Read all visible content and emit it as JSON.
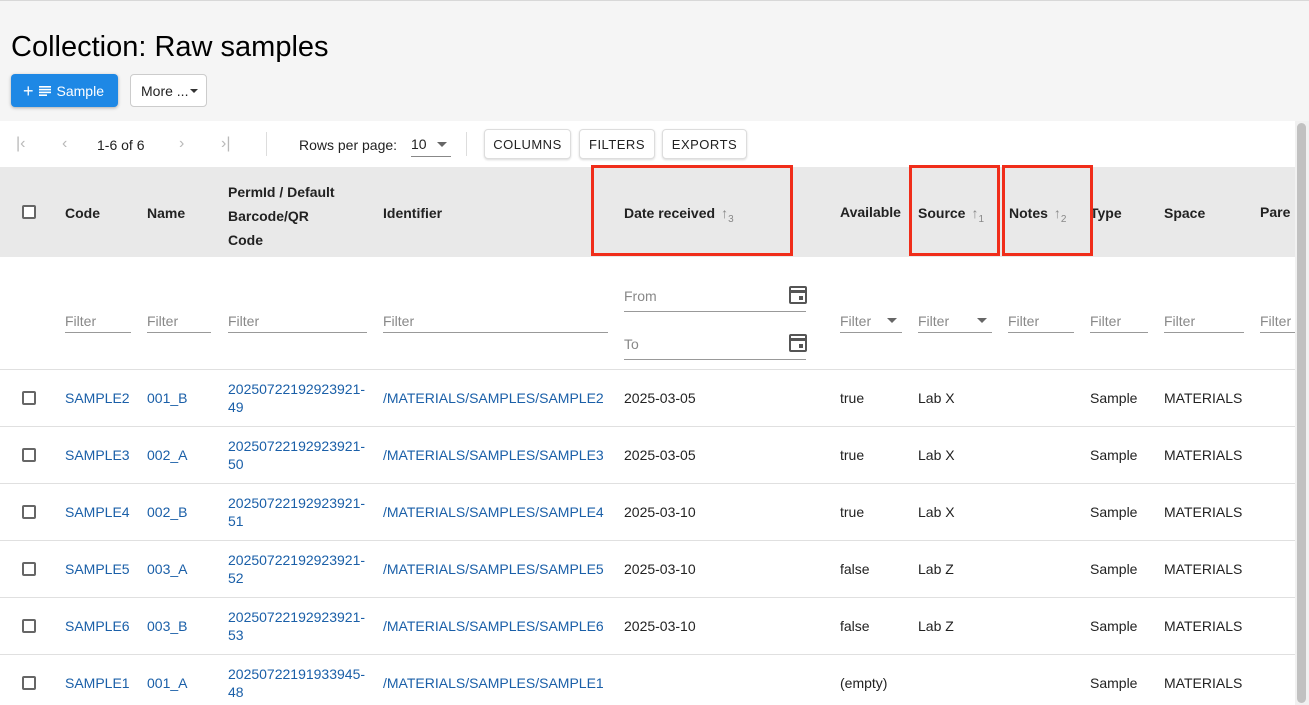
{
  "page": {
    "title": "Collection: Raw samples"
  },
  "actions": {
    "add_label": "Sample",
    "more_label": "More ..."
  },
  "toolbar": {
    "range": "1-6 of 6",
    "rows_per_page_label": "Rows per page:",
    "rows_per_page_value": "10",
    "columns_label": "COLUMNS",
    "filters_label": "FILTERS",
    "exports_label": "EXPORTS"
  },
  "columns": {
    "code": "Code",
    "name": "Name",
    "permid_line1": "PermId / Default",
    "permid_line2": "Barcode/QR",
    "permid_line3": "Code",
    "identifier": "Identifier",
    "date_received": "Date received",
    "date_sort_rank": "3",
    "available": "Available",
    "source": "Source",
    "source_sort_rank": "1",
    "notes": "Notes",
    "notes_sort_rank": "2",
    "type": "Type",
    "space": "Space",
    "parents": "Pare"
  },
  "filters": {
    "placeholder": "Filter",
    "from": "From",
    "to": "To"
  },
  "rows": [
    {
      "code": "SAMPLE2",
      "name": "001_B",
      "permid_a": "20250722192923921-",
      "permid_b": "49",
      "identifier": "/MATERIALS/SAMPLES/SAMPLE2",
      "date": "2025-03-05",
      "available": "true",
      "source": "Lab X",
      "notes": "",
      "type": "Sample",
      "space": "MATERIALS"
    },
    {
      "code": "SAMPLE3",
      "name": "002_A",
      "permid_a": "20250722192923921-",
      "permid_b": "50",
      "identifier": "/MATERIALS/SAMPLES/SAMPLE3",
      "date": "2025-03-05",
      "available": "true",
      "source": "Lab X",
      "notes": "",
      "type": "Sample",
      "space": "MATERIALS"
    },
    {
      "code": "SAMPLE4",
      "name": "002_B",
      "permid_a": "20250722192923921-",
      "permid_b": "51",
      "identifier": "/MATERIALS/SAMPLES/SAMPLE4",
      "date": "2025-03-10",
      "available": "true",
      "source": "Lab X",
      "notes": "",
      "type": "Sample",
      "space": "MATERIALS"
    },
    {
      "code": "SAMPLE5",
      "name": "003_A",
      "permid_a": "20250722192923921-",
      "permid_b": "52",
      "identifier": "/MATERIALS/SAMPLES/SAMPLE5",
      "date": "2025-03-10",
      "available": "false",
      "source": "Lab Z",
      "notes": "",
      "type": "Sample",
      "space": "MATERIALS"
    },
    {
      "code": "SAMPLE6",
      "name": "003_B",
      "permid_a": "20250722192923921-",
      "permid_b": "53",
      "identifier": "/MATERIALS/SAMPLES/SAMPLE6",
      "date": "2025-03-10",
      "available": "false",
      "source": "Lab Z",
      "notes": "",
      "type": "Sample",
      "space": "MATERIALS"
    },
    {
      "code": "SAMPLE1",
      "name": "001_A",
      "permid_a": "20250722191933945-",
      "permid_b": "48",
      "identifier": "/MATERIALS/SAMPLES/SAMPLE1",
      "date": "",
      "available": "(empty)",
      "source": "",
      "notes": "",
      "type": "Sample",
      "space": "MATERIALS"
    }
  ]
}
